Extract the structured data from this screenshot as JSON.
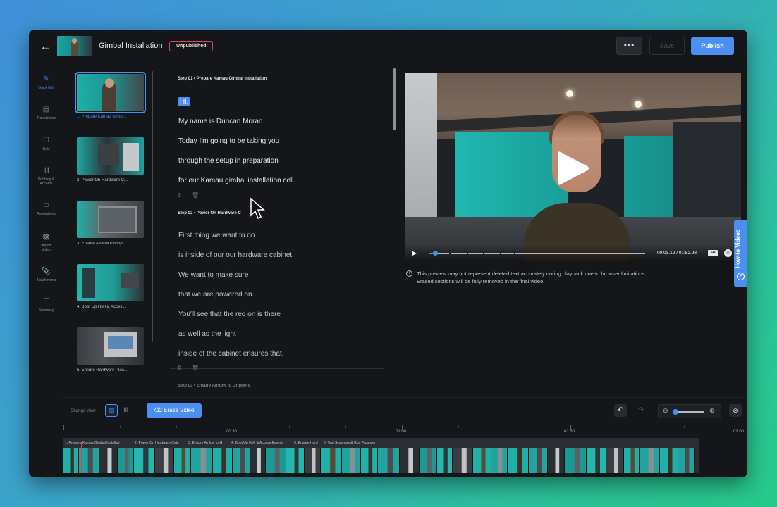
{
  "header": {
    "title": "Gimbal Installation",
    "status": "Unpublished",
    "more_label": "•••",
    "save_label": "Save",
    "publish_label": "Publish"
  },
  "nav": [
    {
      "label": "Quick Edit",
      "icon": "edit-icon"
    },
    {
      "label": "Translations",
      "icon": "translate-icon"
    },
    {
      "label": "Quiz",
      "icon": "quiz-icon"
    },
    {
      "label": "Dubbing & Accents",
      "icon": "audio-wave-icon"
    },
    {
      "label": "Annotations",
      "icon": "annotation-icon"
    },
    {
      "label": "Import Video",
      "icon": "import-icon"
    },
    {
      "label": "Attachments",
      "icon": "paperclip-icon"
    },
    {
      "label": "Summary",
      "icon": "summary-icon"
    }
  ],
  "thumbnails": [
    {
      "label": "1. Prepare Kamau Gimb..."
    },
    {
      "label": "2. Power On Hardware C..."
    },
    {
      "label": "3. Ensure Airflow to Grip..."
    },
    {
      "label": "4. Boot Up HMI & Acces..."
    },
    {
      "label": "5. Ensure Hardware Plac..."
    }
  ],
  "transcript": {
    "steps": [
      {
        "title": "Step 01 • Prepare Kamau Gimbal Installation",
        "highlight": "Hi.",
        "lines": [
          "My name is Duncan Moran.",
          "Today I'm going to be taking you",
          "through the setup in preparation",
          "for our Kamau gimbal installation cell."
        ]
      },
      {
        "title": "Step 02 • Power On Hardware C",
        "lines": [
          "First thing we want to do",
          "is inside of our our hardware cabinet.",
          "We want to make sure",
          "that we are powered on.",
          "You'll see that the red on is there",
          "as well as the light",
          "inside of the cabinet ensures that."
        ]
      },
      {
        "title": "Step 03 • Ensure Airflow to Grippers"
      }
    ]
  },
  "video": {
    "current_time": "00:03.12",
    "separator": "/",
    "duration": "01:52.98",
    "quality": "SD",
    "progress_fraction": 0.027
  },
  "notice": {
    "line1": "This preview may not represent deleted text accurately during playback due to browser limitations.",
    "line2": "Erased sections will be fully removed in the final video."
  },
  "howto": {
    "label": "How-to Videos"
  },
  "toolbar": {
    "change_view_label": "Change view:",
    "erase_label": "Erase Video"
  },
  "timeline": {
    "labels": [
      "00:30",
      "01:00",
      "01:30",
      "02:00"
    ],
    "segments": [
      "1. Prepare Kamau Gimbal Installati",
      "2. Power On Hardware Cabi",
      "3. Ensure Airflow to G",
      "4. Boot Up HMI & Access Executi",
      "5. Ensure Hard",
      "6. Test Scanners & Run Program"
    ]
  },
  "colors": {
    "accent": "#4b8ff0",
    "status_border": "#d8434f",
    "background": "#14161a"
  }
}
